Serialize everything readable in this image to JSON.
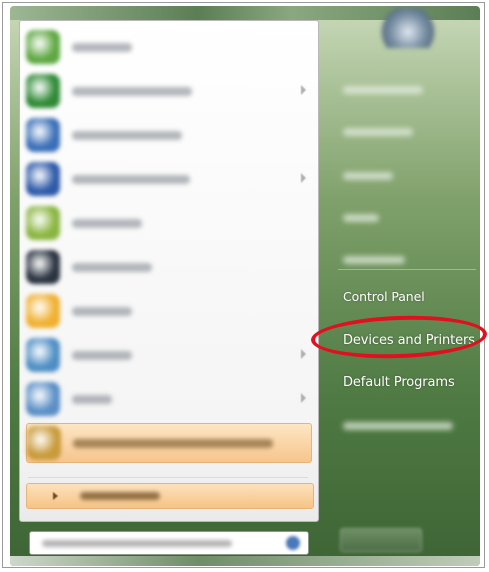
{
  "start_menu": {
    "programs": [
      {
        "icon": "google-talk-icon",
        "color": "#5fa843",
        "label_width": 60,
        "has_arrow": false
      },
      {
        "icon": "excel-icon",
        "color": "#2f8a36",
        "label_width": 120,
        "has_arrow": true
      },
      {
        "icon": "globe-icon",
        "color": "#3a6fb8",
        "label_width": 110,
        "has_arrow": false
      },
      {
        "icon": "word-icon",
        "color": "#2d5aa8",
        "label_width": 118,
        "has_arrow": true
      },
      {
        "icon": "notepad-icon",
        "color": "#8ab540",
        "label_width": 70,
        "has_arrow": false
      },
      {
        "icon": "snipping-tool-icon",
        "color": "#2a3340",
        "label_width": 80,
        "has_arrow": false
      },
      {
        "icon": "snagit-icon",
        "color": "#f0b030",
        "label_width": 60,
        "has_arrow": false
      },
      {
        "icon": "notepad-plus-icon",
        "color": "#4e8ec4",
        "label_width": 60,
        "has_arrow": true
      },
      {
        "icon": "paint-icon",
        "color": "#5a8fc6",
        "label_width": 40,
        "has_arrow": true
      },
      {
        "icon": "snagit-editor-icon",
        "color": "#c89a3a",
        "label_width": 200,
        "has_arrow": false
      }
    ],
    "right_column": {
      "blurred_items": [
        {
          "label_width": 80
        },
        {
          "label_width": 70
        },
        {
          "label_width": 50
        },
        {
          "label_width": 36
        },
        {
          "label_width": 62
        }
      ],
      "control_panel": "Control Panel",
      "devices_and_printers": "Devices and Printers",
      "default_programs": "Default Programs",
      "help_label_width": 110
    }
  },
  "colors": {
    "highlight_ring": "#e0101f",
    "menu_green": "#4f7a43"
  }
}
